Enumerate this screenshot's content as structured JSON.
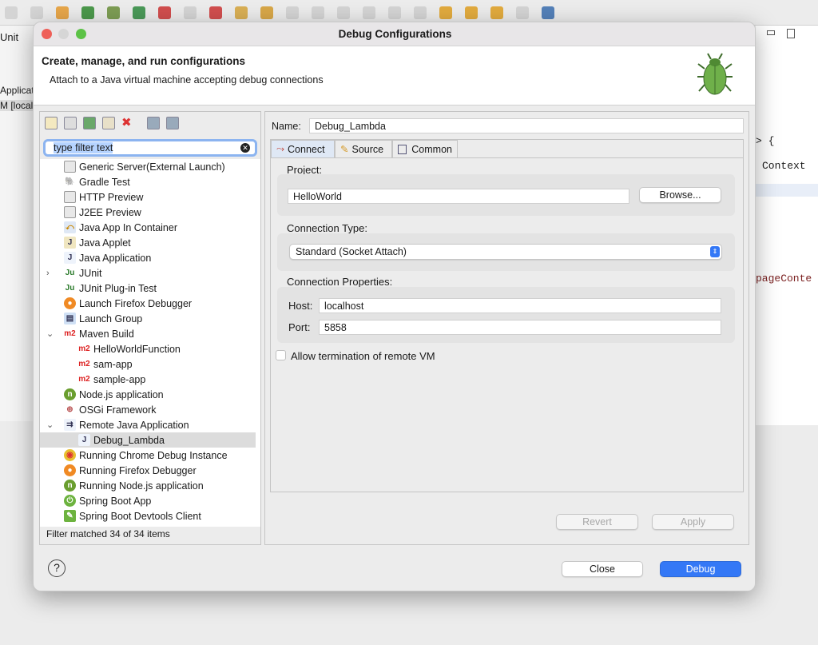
{
  "ide": {
    "left_tab": "Unit",
    "left_rows": [
      "Applicat",
      "M [local"
    ],
    "code_lines": [
      "> {",
      "Context",
      "pageConte"
    ]
  },
  "dialog": {
    "title": "Debug Configurations",
    "header_title": "Create, manage, and run configurations",
    "header_message": "Attach to a Java virtual machine accepting debug connections",
    "toolbar_icons": [
      "new-config-icon",
      "new-prototype-icon",
      "export-icon",
      "duplicate-icon",
      "delete-icon",
      "collapse-all-icon",
      "filter-icon"
    ],
    "filter": {
      "value": "type filter text"
    },
    "tree": [
      {
        "label": "Generic Server(External Launch)",
        "icon": "server-icon",
        "level": 0
      },
      {
        "label": "Gradle Test",
        "icon": "gradle-icon",
        "level": 0
      },
      {
        "label": "HTTP Preview",
        "icon": "server-icon",
        "level": 0
      },
      {
        "label": "J2EE Preview",
        "icon": "server-icon",
        "level": 0
      },
      {
        "label": "Java App In Container",
        "icon": "container-icon",
        "level": 0
      },
      {
        "label": "Java Applet",
        "icon": "applet-icon",
        "level": 0
      },
      {
        "label": "Java Application",
        "icon": "java-app-icon",
        "level": 0
      },
      {
        "label": "JUnit",
        "icon": "junit-icon",
        "level": 0,
        "expander": ">"
      },
      {
        "label": "JUnit Plug-in Test",
        "icon": "junit-plugin-icon",
        "level": 0
      },
      {
        "label": "Launch Firefox Debugger",
        "icon": "firefox-icon",
        "level": 0
      },
      {
        "label": "Launch Group",
        "icon": "launch-group-icon",
        "level": 0
      },
      {
        "label": "Maven Build",
        "icon": "maven-icon",
        "level": 0,
        "expander": "v"
      },
      {
        "label": "HelloWorldFunction",
        "icon": "maven-icon",
        "level": 1
      },
      {
        "label": "sam-app",
        "icon": "maven-icon",
        "level": 1
      },
      {
        "label": "sample-app",
        "icon": "maven-icon",
        "level": 1
      },
      {
        "label": "Node.js application",
        "icon": "nodejs-icon",
        "level": 0
      },
      {
        "label": "OSGi Framework",
        "icon": "osgi-icon",
        "level": 0
      },
      {
        "label": "Remote Java Application",
        "icon": "remote-java-icon",
        "level": 0,
        "expander": "v"
      },
      {
        "label": "Debug_Lambda",
        "icon": "java-app-icon",
        "level": 1,
        "selected": true
      },
      {
        "label": "Running Chrome Debug Instance",
        "icon": "chrome-icon",
        "level": 0
      },
      {
        "label": "Running Firefox Debugger",
        "icon": "firefox-icon",
        "level": 0
      },
      {
        "label": "Running Node.js application",
        "icon": "nodejs-icon",
        "level": 0
      },
      {
        "label": "Spring Boot App",
        "icon": "spring-icon",
        "level": 0
      },
      {
        "label": "Spring Boot Devtools Client",
        "icon": "spring-devtools-icon",
        "level": 0
      }
    ],
    "filter_status": "Filter matched 34 of 34 items",
    "name_label": "Name:",
    "name_value": "Debug_Lambda",
    "tabs": [
      {
        "label": "Connect",
        "active": true
      },
      {
        "label": "Source"
      },
      {
        "label": "Common"
      }
    ],
    "project_label": "Project:",
    "project_value": "HelloWorld",
    "browse": "Browse...",
    "connection_type_label": "Connection Type:",
    "connection_type_value": "Standard (Socket Attach)",
    "connection_props_label": "Connection Properties:",
    "host_label": "Host:",
    "host_value": "localhost",
    "port_label": "Port:",
    "port_value": "5858",
    "allow_termination": {
      "label": "Allow termination of remote VM",
      "checked": false
    },
    "revert": "Revert",
    "apply": "Apply",
    "close": "Close",
    "debug": "Debug",
    "colors": {
      "accent": "#3478f6",
      "close_light": "#ee5f58",
      "min_light": "#d6d6d6",
      "max_light": "#5cc246"
    }
  }
}
